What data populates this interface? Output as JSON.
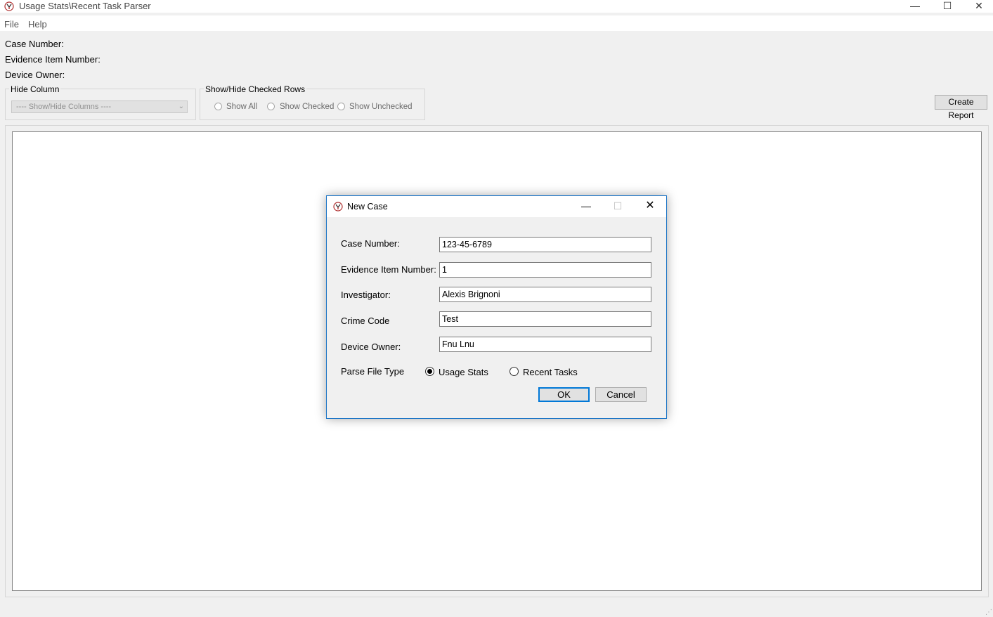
{
  "window": {
    "title": "Usage Stats\\Recent Task Parser",
    "minimize_glyph": "—",
    "maximize_glyph": "☐",
    "close_glyph": "✕"
  },
  "menu": {
    "file": "File",
    "help": "Help"
  },
  "case_info": {
    "case_number_label": "Case Number:",
    "evidence_item_label": "Evidence Item Number:",
    "device_owner_label": "Device Owner:"
  },
  "hide_column": {
    "title": "Hide Column",
    "combo_value": "---- Show/Hide Columns ----",
    "chevron": "⌄"
  },
  "checked_rows": {
    "title": "Show/Hide Checked Rows",
    "options": [
      "Show All",
      "Show Checked",
      "Show Unchecked"
    ]
  },
  "toolbar": {
    "create_report": "Create Report"
  },
  "dialog": {
    "title": "New Case",
    "minimize_glyph": "—",
    "maximize_glyph": "☐",
    "close_glyph": "✕",
    "fields": {
      "case_number": {
        "label": "Case Number:",
        "value": "123-45-6789"
      },
      "evidence_item": {
        "label": "Evidence Item Number:",
        "value": "1"
      },
      "investigator": {
        "label": "Investigator:",
        "value": "Alexis Brignoni"
      },
      "crime_code": {
        "label": "Crime Code",
        "value": "Test"
      },
      "device_owner": {
        "label": "Device Owner:",
        "value": "Fnu Lnu"
      }
    },
    "parse_type": {
      "label": "Parse File Type",
      "options": [
        {
          "label": "Usage Stats",
          "selected": true
        },
        {
          "label": "Recent Tasks",
          "selected": false
        }
      ]
    },
    "ok": "OK",
    "cancel": "Cancel"
  },
  "colors": {
    "accent": "#0078d7",
    "dialog_border": "#1a74c6",
    "window_bg": "#f0f0f0"
  }
}
